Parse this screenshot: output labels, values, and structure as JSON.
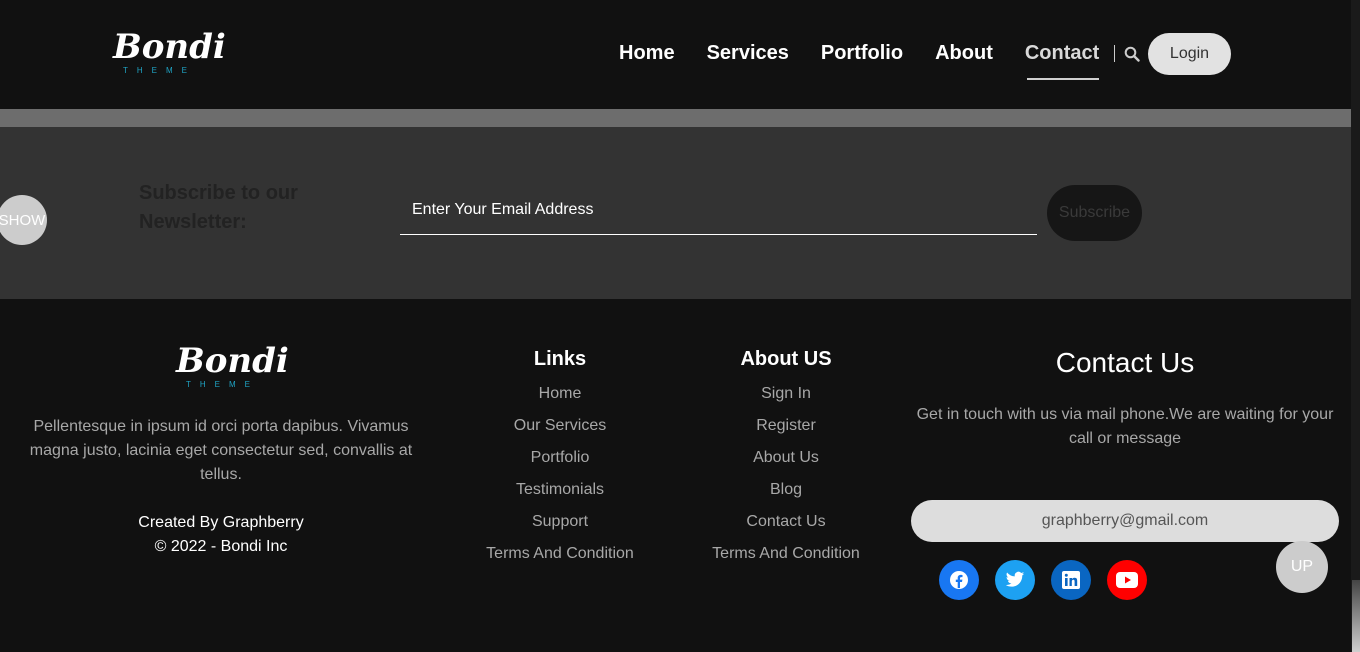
{
  "brand": {
    "name": "Bondi",
    "tagline": "THEME"
  },
  "nav": {
    "items": [
      {
        "label": "Home"
      },
      {
        "label": "Services"
      },
      {
        "label": "Portfolio"
      },
      {
        "label": "About"
      },
      {
        "label": "Contact",
        "active": true
      }
    ],
    "login_label": "Login"
  },
  "newsletter": {
    "show_label": "SHOW",
    "title": "Subscribe to our Newsletter:",
    "email_placeholder": "Enter Your Email Address",
    "subscribe_label": "Subscribe"
  },
  "footer": {
    "description": "Pellentesque in ipsum id orci porta dapibus. Vivamus magna justo, lacinia eget consectetur sed, convallis at tellus.",
    "created_by": "Created By Graphberry",
    "copyright": "© 2022 - Bondi Inc",
    "links": {
      "title": "Links",
      "items": [
        "Home",
        "Our Services",
        "Portfolio",
        "Testimonials",
        "Support",
        "Terms And Condition"
      ]
    },
    "about": {
      "title": "About US",
      "items": [
        "Sign In",
        "Register",
        "About Us",
        "Blog",
        "Contact Us",
        "Terms And Condition"
      ]
    },
    "contact": {
      "title": "Contact Us",
      "description": "Get in touch with us via mail phone.We are waiting for your call or message",
      "email": "graphberry@gmail.com"
    },
    "socials": [
      {
        "icon": "facebook-icon",
        "color": "#1877f2"
      },
      {
        "icon": "twitter-icon",
        "color": "#1da1f2"
      },
      {
        "icon": "linkedin-icon",
        "color": "#0a66c2"
      },
      {
        "icon": "youtube-icon",
        "color": "#ff0000"
      }
    ],
    "up_label": "UP"
  }
}
